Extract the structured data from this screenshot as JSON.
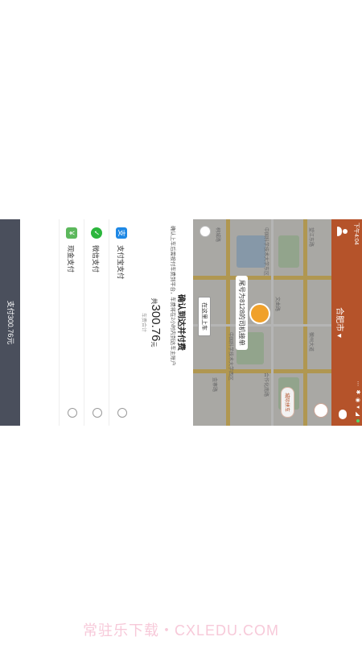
{
  "status_bar": {
    "time": "下午4:04",
    "signals": "⋯ ✱ ◉ ▾ ◢"
  },
  "header": {
    "city": "合肥市 ▾"
  },
  "map": {
    "tag_button": "城际拼车",
    "pin_label": "尾号为8128的司机接单",
    "board_button": "在这里上车",
    "labels": [
      "望江东路",
      "文曲路",
      "中国科学技术大学西区",
      "中国科学技术大学东区",
      "徽州大道",
      "合作化南路",
      "金寨路",
      "桐城路"
    ]
  },
  "sheet": {
    "title": "确认到达并付费",
    "description": "确认上车后需按付车费到平台，车费将在2小时内到达车主账户",
    "amount_prefix": "共",
    "amount_value": "300.76",
    "amount_unit": "元",
    "amount_subtitle": "车费合计",
    "payment_methods": [
      {
        "label": "支付宝支付",
        "icon": "alipay-icon",
        "color": "#1e88e5",
        "glyph": "支"
      },
      {
        "label": "微信支付",
        "icon": "wechat-pay-icon",
        "color": "#2bb63c",
        "glyph": "✓"
      },
      {
        "label": "现金支付",
        "icon": "cash-icon",
        "color": "#5cb85c",
        "glyph": "¥"
      }
    ],
    "pay_button": "支付300.76元"
  },
  "watermark": "常驻乐下载・CXLEDU.COM",
  "colors": {
    "brand": "#b5532a",
    "pay_button": "#4a4f5c"
  }
}
